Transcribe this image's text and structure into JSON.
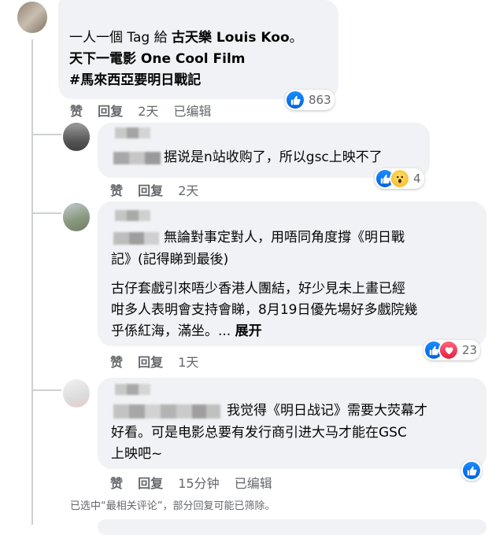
{
  "comments": [
    {
      "lines": [
        "一人一個 Tag 給 ",
        "古天樂 Louis Koo",
        "。"
      ],
      "line2": "天下一電影 One Cool Film",
      "line3": "#馬來西亞要明日戰記",
      "actions": {
        "like": "赞",
        "reply": "回复",
        "time": "2天",
        "edited": "已编辑"
      },
      "reaction_count": "863"
    },
    {
      "text": "据说是n站收购了，所以gsc上映不了",
      "actions": {
        "like": "赞",
        "reply": "回复",
        "time": "2天"
      },
      "reaction_count": "4"
    },
    {
      "line1": "無論對事定對人，用唔同角度撐《明日戰",
      "line2": "記》(記得睇到最後)",
      "line3": "古仔套戲引來唔少香港人團結，好少見未上畫已經",
      "line4": "咁多人表明會支持會睇，8月19日優先場好多戲院幾",
      "line5": "乎係紅海，滿坐。...",
      "see_more": "展开",
      "actions": {
        "like": "赞",
        "reply": "回复",
        "time": "1天"
      },
      "reaction_count": "23"
    },
    {
      "line1": "我觉得《明日战记》需要大荧幕才",
      "line2": "好看。可是电影总要有发行商引进大马才能在GSC",
      "line3": "上映吧~",
      "actions": {
        "like": "赞",
        "reply": "回复",
        "time": "15分钟",
        "edited": "已编辑"
      }
    }
  ],
  "footnote": "已选中“最相关评论”，部分回复可能已筛除。",
  "colors": {
    "bubble": "#f0f2f5",
    "like_blue": "#1877f2",
    "love_red": "#f33e58",
    "meta_gray": "#65676b"
  }
}
